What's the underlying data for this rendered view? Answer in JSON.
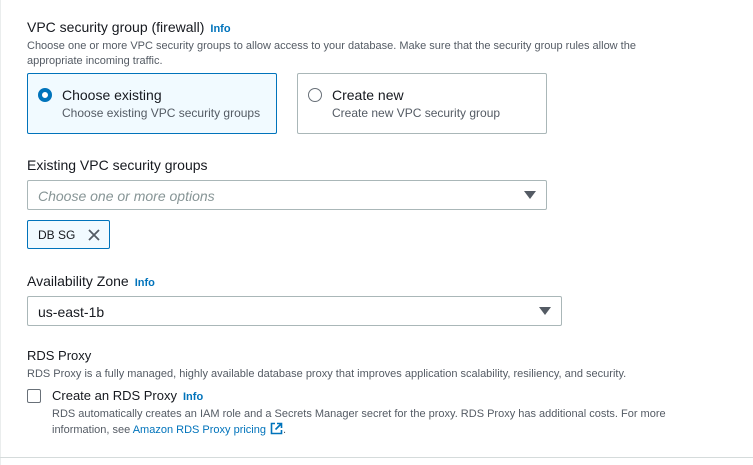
{
  "vpc_sg": {
    "title": "VPC security group (firewall)",
    "info": "Info",
    "description_line1": "Choose one or more VPC security groups to allow access to your database. Make sure that the security group rules allow the",
    "description_line2": "appropriate incoming traffic.",
    "options": [
      {
        "title": "Choose existing",
        "description": "Choose existing VPC security groups",
        "selected": true
      },
      {
        "title": "Create new",
        "description": "Create new VPC security group",
        "selected": false
      }
    ]
  },
  "existing_sg": {
    "label": "Existing VPC security groups",
    "placeholder": "Choose one or more options",
    "tokens": [
      "DB SG"
    ]
  },
  "availability_zone": {
    "label": "Availability Zone",
    "info": "Info",
    "value": "us-east-1b"
  },
  "rds_proxy": {
    "title": "RDS Proxy",
    "description": "RDS Proxy is a fully managed, highly available database proxy that improves application scalability, resiliency, and security.",
    "checkbox_label": "Create an RDS Proxy",
    "info": "Info",
    "checked": false,
    "note_line1": "RDS automatically creates an IAM role and a Secrets Manager secret for the proxy. RDS Proxy has additional costs. For more",
    "note_line2_prefix": "information, see ",
    "link_text": "Amazon RDS Proxy pricing",
    "note_line2_suffix": "."
  },
  "colors": {
    "accent": "#0073bb",
    "selected_bg": "#f1faff",
    "border": "#aab7b8",
    "text": "#16191f",
    "secondary_text": "#545b64"
  }
}
